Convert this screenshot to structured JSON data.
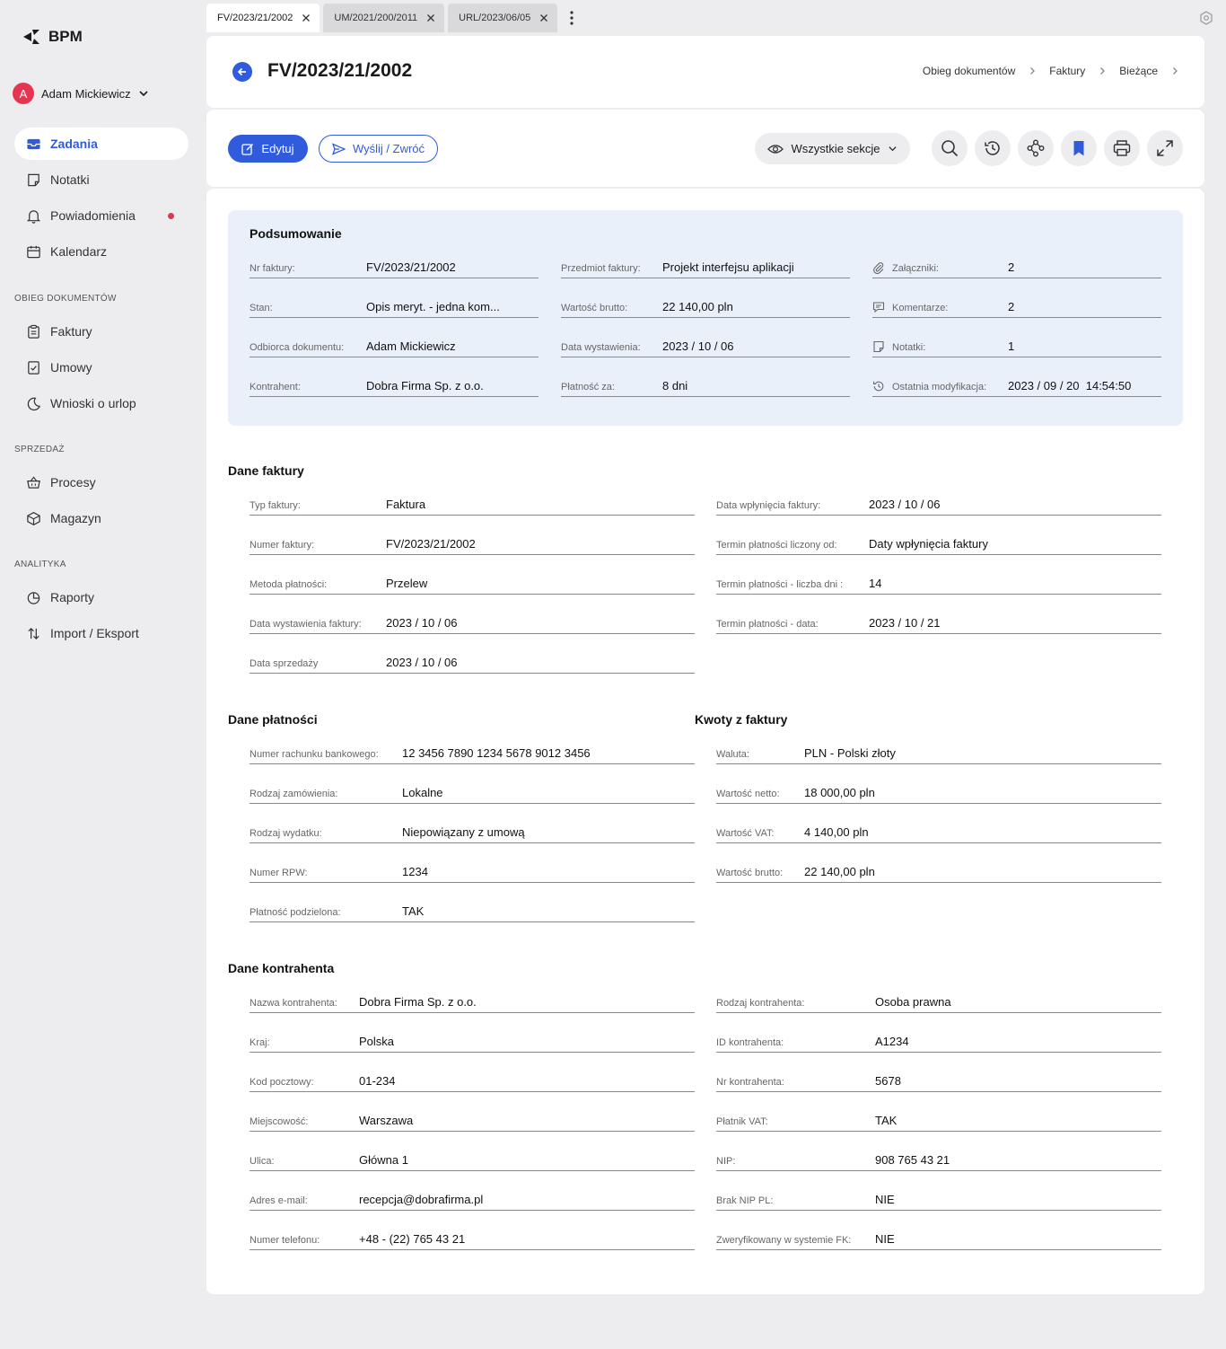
{
  "app": {
    "name": "BPM",
    "user": "Adam Mickiewicz",
    "user_initial": "A"
  },
  "nav": {
    "items": [
      "Zadania",
      "Notatki",
      "Powiadomienia",
      "Kalendarz"
    ],
    "group1_title": "OBIEG DOKUMENTÓW",
    "group1": [
      "Faktury",
      "Umowy",
      "Wnioski o urlop"
    ],
    "group2_title": "SPRZEDAŻ",
    "group2": [
      "Procesy",
      "Magazyn"
    ],
    "group3_title": "ANALITYKA",
    "group3": [
      "Raporty",
      "Import / Eksport"
    ]
  },
  "tabs": [
    "FV/2023/21/2002",
    "UM/2021/200/2011",
    "URL/2023/06/05"
  ],
  "header": {
    "title": "FV/2023/21/2002",
    "breadcrumbs": [
      "Obieg dokumentów",
      "Faktury",
      "Bieżące"
    ]
  },
  "toolbar": {
    "edit_label": "Edytuj",
    "send_label": "Wyślij / Zwróć",
    "sections_label": "Wszystkie sekcje",
    "icons": [
      "search-icon",
      "history-icon",
      "workflow-icon",
      "bookmark-icon",
      "print-icon",
      "expand-icon"
    ],
    "accent": "#2f5bdc"
  },
  "summary": {
    "title": "Podsumowanie",
    "col1": [
      {
        "label": "Nr faktury:",
        "value": "FV/2023/21/2002"
      },
      {
        "label": "Stan:",
        "value": "Opis meryt. - jedna kom..."
      },
      {
        "label": "Odbiorca dokumentu:",
        "value": "Adam Mickiewicz"
      },
      {
        "label": "Kontrahent:",
        "value": "Dobra Firma Sp. z o.o."
      }
    ],
    "col2": [
      {
        "label": "Przedmiot faktury:",
        "value": "Projekt interfejsu aplikacji"
      },
      {
        "label": "Wartość brutto:",
        "value": "22 140,00 pln"
      },
      {
        "label": "Data wystawienia:",
        "value": "2023 / 10 / 06"
      },
      {
        "label": "Płatność za:",
        "value": "8 dni"
      }
    ],
    "col3": [
      {
        "label": "Załączniki:",
        "value": "2"
      },
      {
        "label": "Komentarze:",
        "value": "2"
      },
      {
        "label": "Notatki:",
        "value": "1"
      },
      {
        "label": "Ostatnia modyfikacja:",
        "value": "2023 / 09 / 20  14:54:50"
      }
    ]
  },
  "invoice": {
    "title": "Dane faktury",
    "left": [
      {
        "label": "Typ faktury:",
        "value": "Faktura"
      },
      {
        "label": "Numer faktury:",
        "value": "FV/2023/21/2002"
      },
      {
        "label": "Metoda płatności:",
        "value": "Przelew"
      },
      {
        "label": "Data wystawienia faktury:",
        "value": "2023 / 10 / 06"
      },
      {
        "label": "Data sprzedaży",
        "value": "2023 / 10 / 06"
      }
    ],
    "right": [
      {
        "label": "Data wpłynięcia faktury:",
        "value": "2023 / 10 / 06"
      },
      {
        "label": "Termin płatności liczony od:",
        "value": "Daty wpłynięcia faktury"
      },
      {
        "label": "Termin płatności - liczba dni :",
        "value": "14"
      },
      {
        "label": "Termin płatności - data:",
        "value": "2023 / 10 / 21"
      }
    ]
  },
  "payment": {
    "title": "Dane płatności",
    "rows": [
      {
        "label": "Numer rachunku bankowego:",
        "value": "12 3456 7890 1234 5678 9012 3456"
      },
      {
        "label": "Rodzaj zamówienia:",
        "value": "Lokalne"
      },
      {
        "label": "Rodzaj wydatku:",
        "value": "Niepowiązany z umową"
      },
      {
        "label": "Numer RPW:",
        "value": "1234"
      },
      {
        "label": "Płatność podzielona:",
        "value": "TAK"
      }
    ]
  },
  "amounts": {
    "title": "Kwoty z faktury",
    "rows": [
      {
        "label": "Waluta:",
        "value": "PLN - Polski złoty"
      },
      {
        "label": "Wartość netto:",
        "value": "18 000,00 pln"
      },
      {
        "label": "Wartość VAT:",
        "value": "4 140,00 pln"
      },
      {
        "label": "Wartość brutto:",
        "value": "22 140,00 pln"
      }
    ]
  },
  "contractor": {
    "title": "Dane kontrahenta",
    "left": [
      {
        "label": "Nazwa kontrahenta:",
        "value": "Dobra Firma Sp. z o.o."
      },
      {
        "label": "Kraj:",
        "value": "Polska"
      },
      {
        "label": "Kod pocztowy:",
        "value": "01-234"
      },
      {
        "label": "Miejscowość:",
        "value": "Warszawa"
      },
      {
        "label": "Ulica:",
        "value": "Główna 1"
      },
      {
        "label": "Adres e-mail:",
        "value": "recepcja@dobrafirma.pl"
      },
      {
        "label": "Numer telefonu:",
        "value": "+48 - (22) 765 43 21"
      }
    ],
    "right": [
      {
        "label": "Rodzaj kontrahenta:",
        "value": "Osoba prawna"
      },
      {
        "label": "ID kontrahenta:",
        "value": "A1234"
      },
      {
        "label": "Nr kontrahenta:",
        "value": "5678"
      },
      {
        "label": "Płatnik VAT:",
        "value": "TAK"
      },
      {
        "label": "NIP:",
        "value": "908 765 43 21"
      },
      {
        "label": "Brak NIP PL:",
        "value": "NIE"
      },
      {
        "label": "Zweryfikowany w systemie FK:",
        "value": "NIE"
      }
    ]
  }
}
